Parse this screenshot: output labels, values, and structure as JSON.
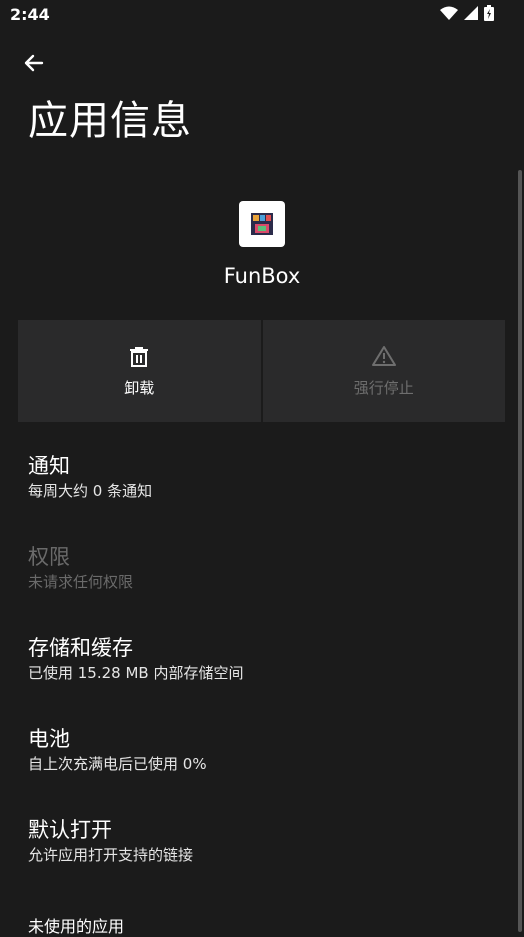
{
  "status": {
    "time": "2:44"
  },
  "page": {
    "title": "应用信息"
  },
  "app": {
    "name": "FunBox"
  },
  "actions": [
    {
      "label": "卸载",
      "icon": "trash-icon",
      "enabled": true
    },
    {
      "label": "强行停止",
      "icon": "warning-icon",
      "enabled": false
    }
  ],
  "settings": [
    {
      "title": "通知",
      "subtitle": "每周大约 0 条通知",
      "enabled": true
    },
    {
      "title": "权限",
      "subtitle": "未请求任何权限",
      "enabled": false
    },
    {
      "title": "存储和缓存",
      "subtitle": "已使用 15.28 MB 内部存储空间",
      "enabled": true
    },
    {
      "title": "电池",
      "subtitle": "自上次充满电后已使用 0%",
      "enabled": true
    },
    {
      "title": "默认打开",
      "subtitle": "允许应用打开支持的链接",
      "enabled": true
    }
  ],
  "section": {
    "unused_apps": "未使用的应用"
  },
  "colors": {
    "background": "#1b1b1b",
    "card": "#2a2a2b",
    "disabled_text": "#6a6a6a"
  }
}
